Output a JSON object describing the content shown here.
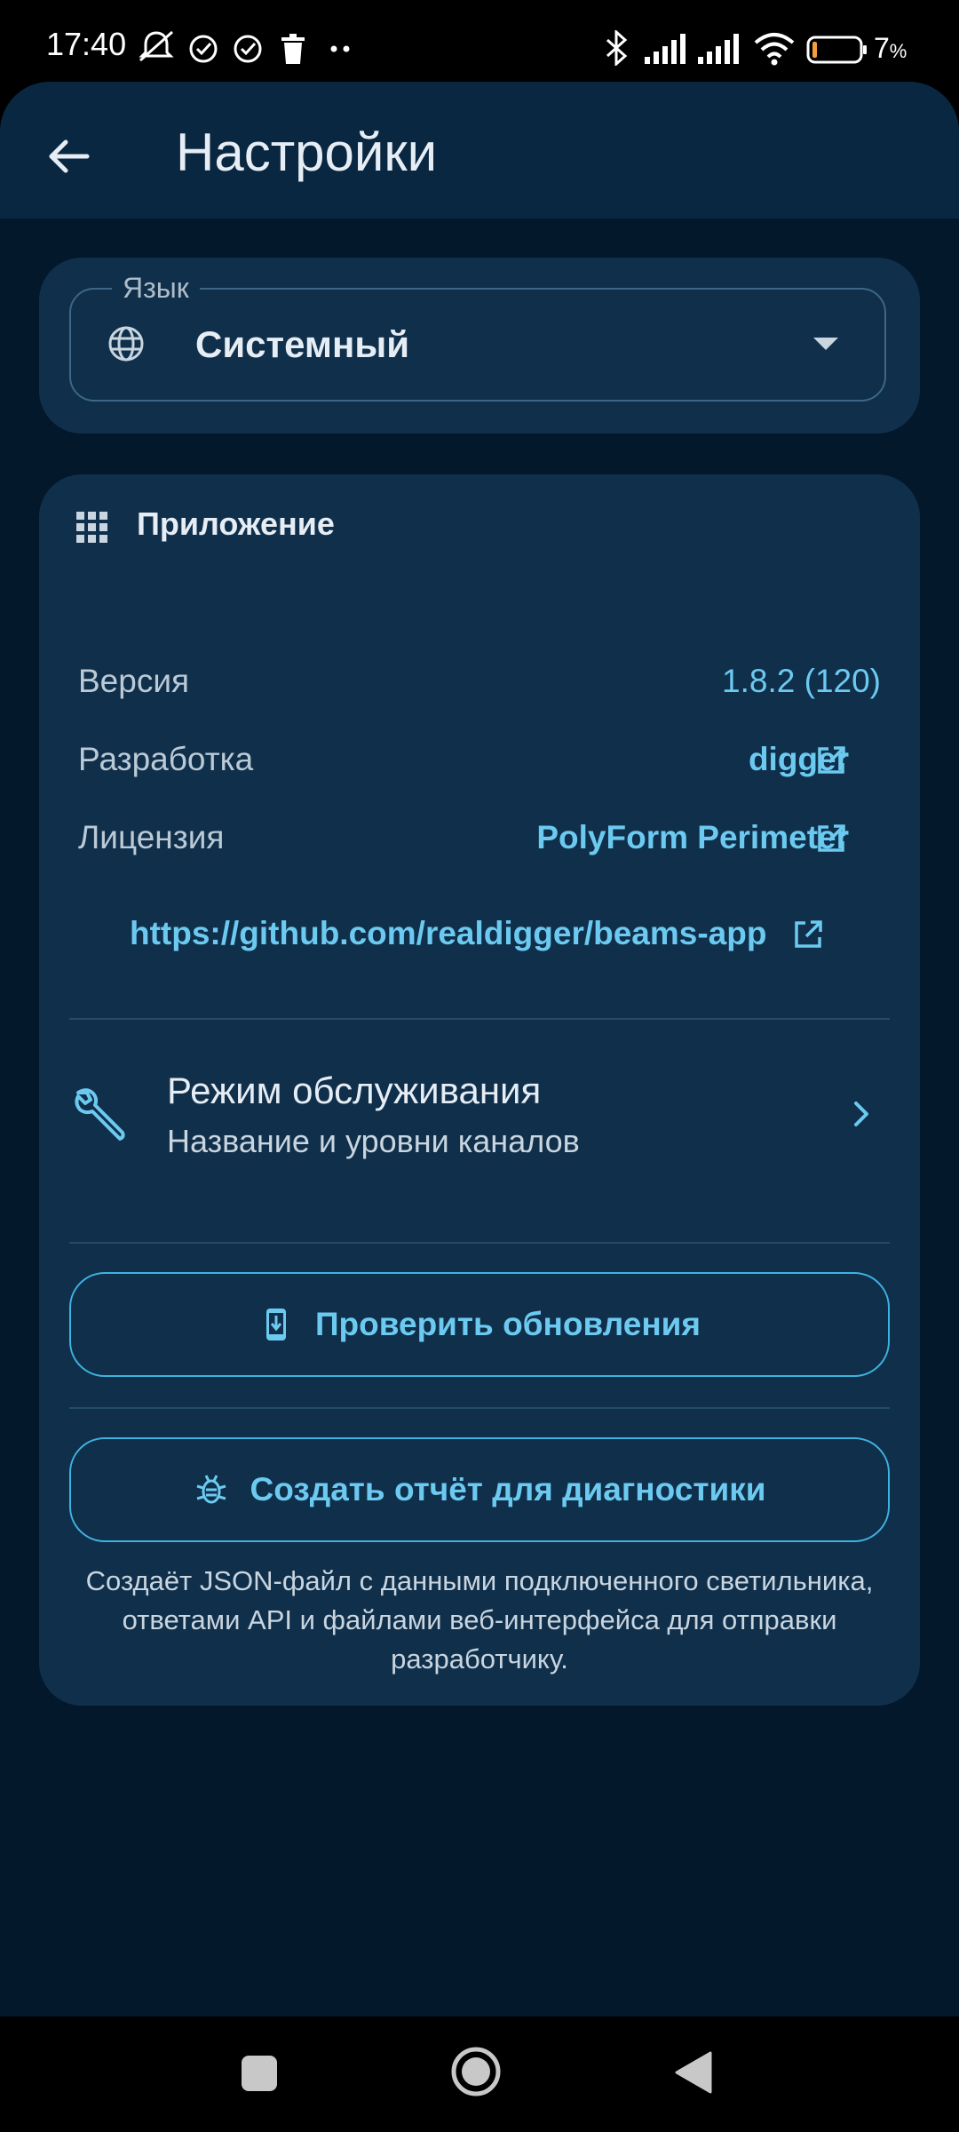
{
  "status_bar": {
    "time": "17:40",
    "battery_pct": "7",
    "battery_unit": "%",
    "icons": [
      "muted-bell-icon",
      "check-circle-icon",
      "check-circle-icon",
      "trash-icon",
      "more-dots-icon",
      "bluetooth-icon",
      "signal-icon",
      "signal-icon",
      "wifi-icon",
      "battery-icon"
    ]
  },
  "appbar": {
    "title": "Настройки",
    "back_icon": "arrow-left-icon"
  },
  "language": {
    "label": "Язык",
    "value": "Системный",
    "icon": "globe-icon"
  },
  "app_section": {
    "title": "Приложение",
    "icon": "apps-grid-icon",
    "rows": [
      {
        "label": "Версия",
        "value": "1.8.2 (120)"
      },
      {
        "label": "Разработка",
        "value": "digger",
        "link": true
      },
      {
        "label": "Лицензия",
        "value": "PolyForm Perimeter",
        "link": true
      }
    ],
    "repo_url": "https://github.com/realdigger/beams-app"
  },
  "maintenance": {
    "title": "Режим обслуживания",
    "subtitle": "Название и уровни каналов",
    "icon": "wrench-icon"
  },
  "buttons": {
    "check_updates": "Проверить обновления",
    "diagnostics": "Создать отчёт для диагностики"
  },
  "diagnostics_note": "Создаёт JSON-файл с данными подключенного светильника, ответами API и файлами веб-интерфейса для отправки разработчику.",
  "colors": {
    "background": "#04182b",
    "appbar": "#092740",
    "card": "#0f2f4b",
    "accent": "#6ccaf0",
    "text": "#e6edf4"
  }
}
